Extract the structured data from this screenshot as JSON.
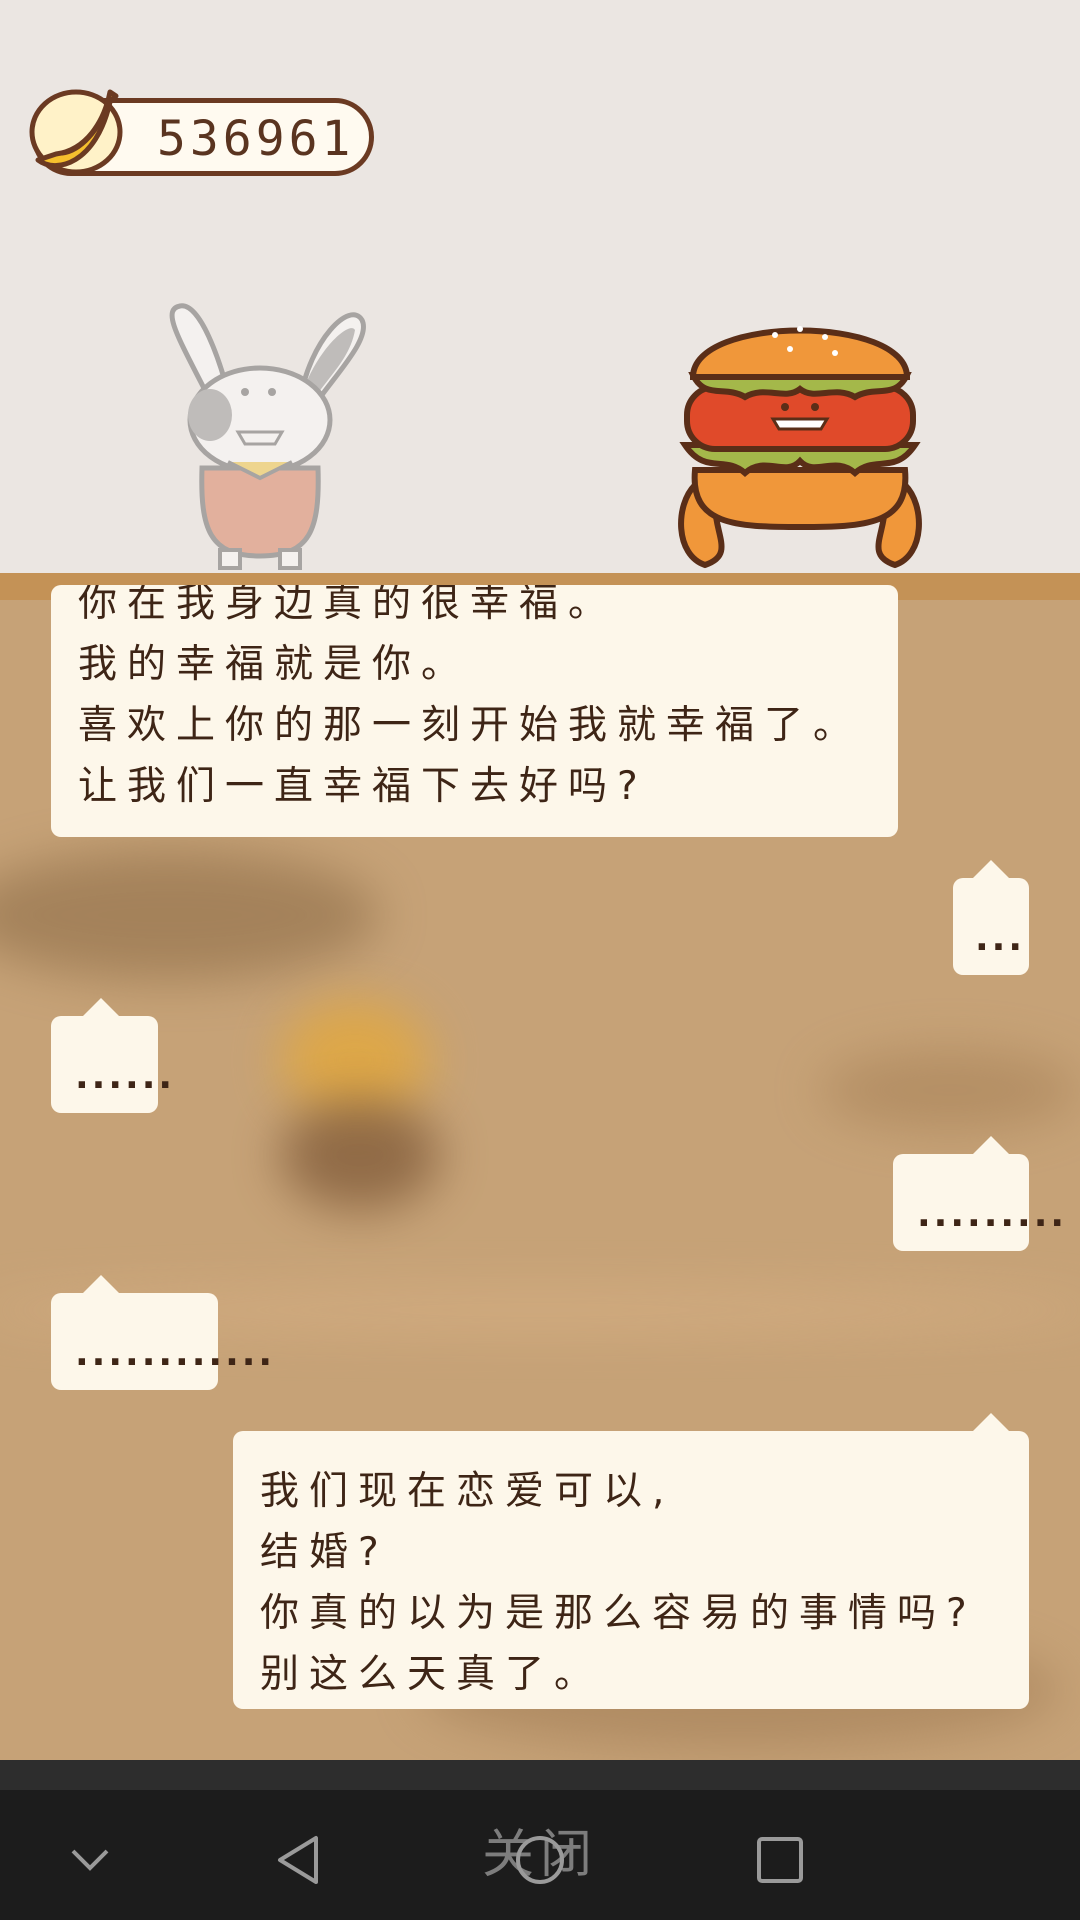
{
  "hud": {
    "banana_count": "536961",
    "icon": "banana-icon"
  },
  "characters": {
    "left": "rabbit-character",
    "right": "burger-character"
  },
  "chat": {
    "msg1": [
      "你在我身边真的很幸福。",
      "我的幸福就是你。",
      "喜欢上你的那一刻开始我就幸福了。",
      "让我们一直幸福下去好吗?"
    ],
    "msg2": "...",
    "msg3": "......",
    "msg4": ".........",
    "msg5": "............",
    "msg6": [
      "我们现在恋爱可以,",
      "结婚?",
      "你真的以为是那么容易的事情吗?",
      "别这么天真了。"
    ]
  },
  "navbar": {
    "close_label": "关闭",
    "icons": [
      "chevron-down-icon",
      "back-triangle-icon",
      "home-circle-icon",
      "recents-square-icon"
    ]
  },
  "colors": {
    "brown_outline": "#6b3a22",
    "bubble_bg": "#fdf7ea",
    "chat_bg": "#c6a277",
    "divider": "#c49256"
  }
}
